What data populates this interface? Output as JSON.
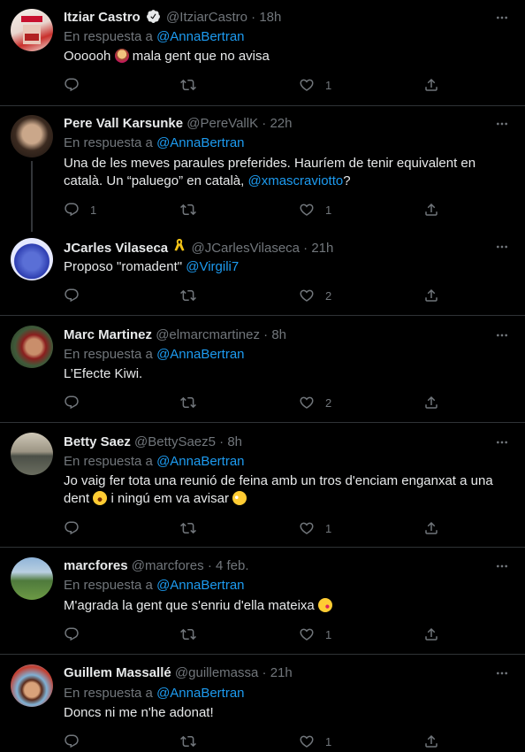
{
  "reply_prefix": "En respuesta a",
  "tweets": [
    {
      "name": "Itziar Castro",
      "handle": "@ItziarCastro",
      "time": "18h",
      "reply_to": "@AnnaBertran",
      "text": "Oooooh",
      "text2": "mala gent que no avisa",
      "reply_count": "",
      "retweet_count": "",
      "like_count": "1"
    },
    {
      "name": "Pere Vall Karsunke",
      "handle": "@PereVallK",
      "time": "22h",
      "reply_to": "@AnnaBertran",
      "text": "Una de les meves paraules preferides. Hauríem de tenir equivalent en català. Un “paluego” en català,",
      "mention": "@xmascraviotto",
      "text_end": "?",
      "reply_count": "1",
      "retweet_count": "",
      "like_count": "1"
    },
    {
      "name": "JCarles Vilaseca",
      "handle": "@JCarlesVilaseca",
      "time": "21h",
      "text": "Proposo \"romadent\"",
      "mention": "@Virgili7",
      "reply_count": "",
      "retweet_count": "",
      "like_count": "2"
    },
    {
      "name": "Marc Martinez",
      "handle": "@elmarcmartinez",
      "time": "8h",
      "reply_to": "@AnnaBertran",
      "text": "L’Efecte Kiwi.",
      "reply_count": "",
      "retweet_count": "",
      "like_count": "2"
    },
    {
      "name": "Betty Saez",
      "handle": "@BettySaez5",
      "time": "8h",
      "reply_to": "@AnnaBertran",
      "text": "Jo vaig fer tota una reunió de feina amb un tros d'enciam enganxat a una",
      "text2": "dent",
      "text3": "i ningú em va avisar",
      "reply_count": "",
      "retweet_count": "",
      "like_count": "1"
    },
    {
      "name": "marcfores",
      "handle": "@marcfores",
      "time": "4 feb.",
      "reply_to": "@AnnaBertran",
      "text": "M'agrada la gent que s'enriu d'ella mateixa",
      "reply_count": "",
      "retweet_count": "",
      "like_count": "1"
    },
    {
      "name": "Guillem Massallé",
      "handle": "@guillemassa",
      "time": "21h",
      "reply_to": "@AnnaBertran",
      "text": "Doncs ni me n'he adonat!",
      "reply_count": "",
      "retweet_count": "",
      "like_count": "1"
    }
  ],
  "colors": {
    "background": "#000000",
    "text": "#e7e9ea",
    "muted": "#71767b",
    "link": "#1d9bf0",
    "border": "#2f3336",
    "verified": "#e7e9ea"
  },
  "icons": [
    "verified-icon",
    "yellow-ribbon-icon",
    "more-icon",
    "reply-icon",
    "retweet-icon",
    "like-icon",
    "share-icon"
  ]
}
